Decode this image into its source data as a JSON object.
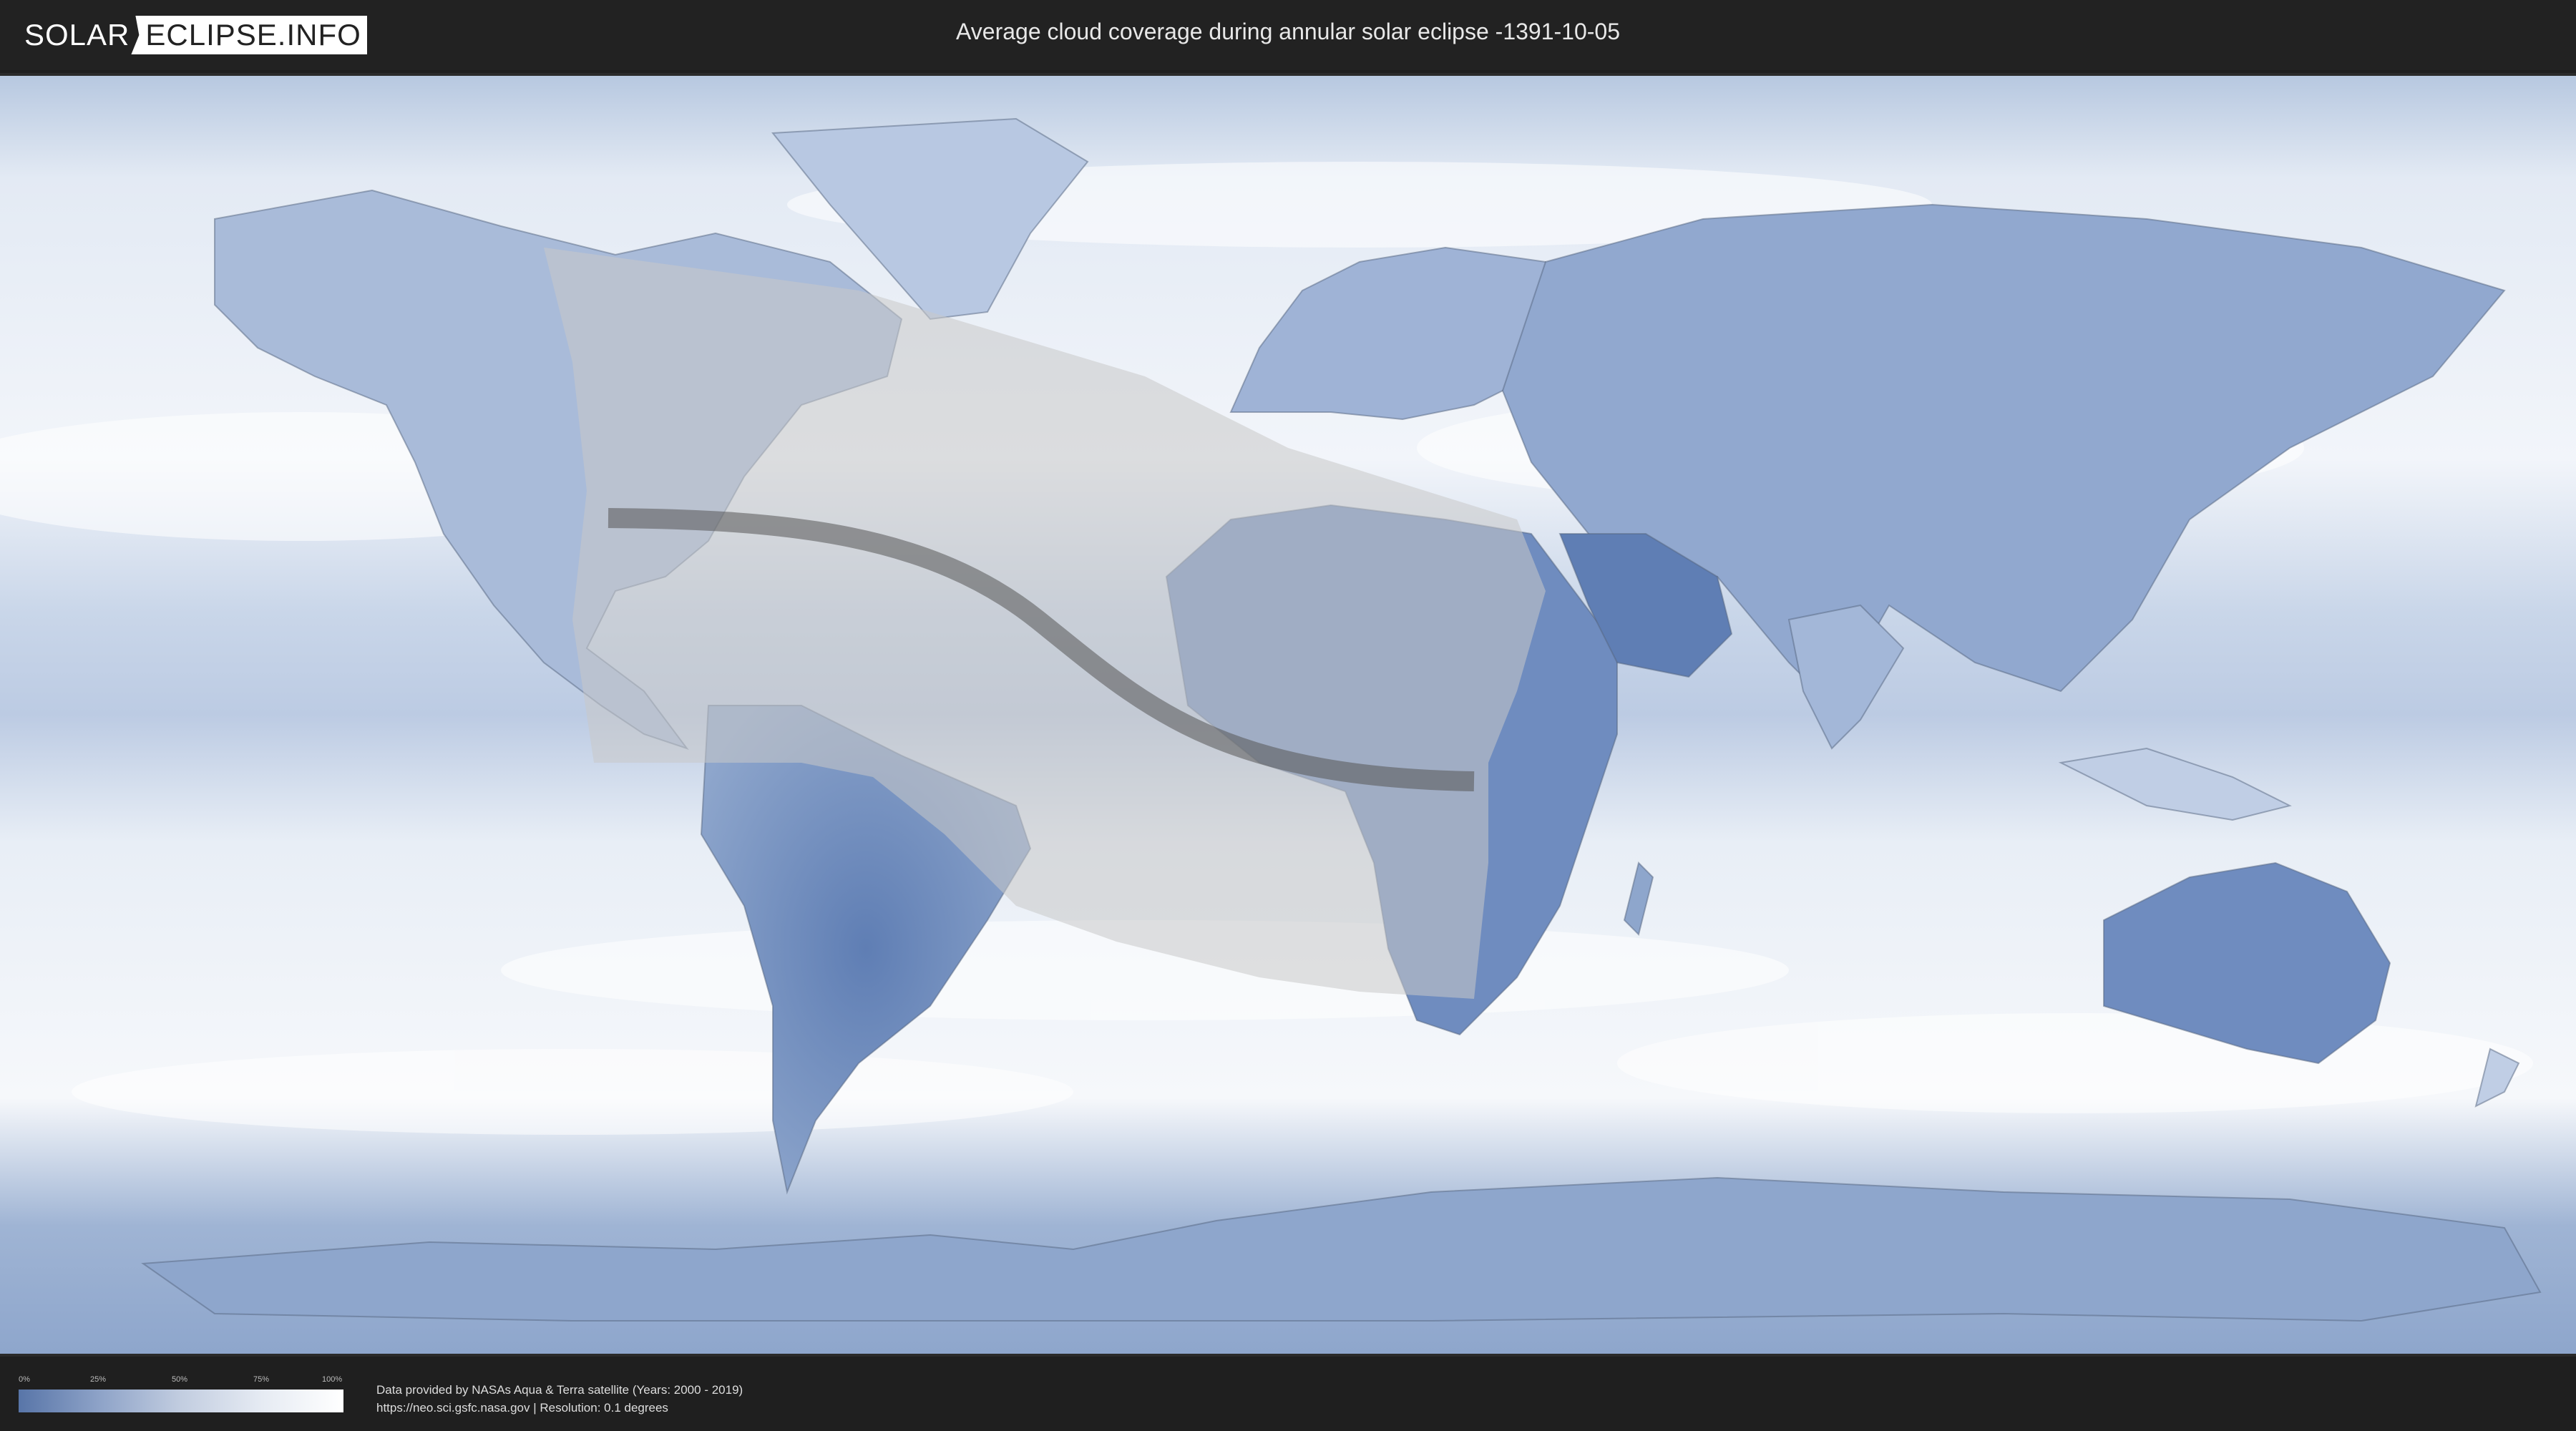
{
  "header": {
    "logo_left": "SOLAR",
    "logo_right": "ECLIPSE.INFO",
    "title": "Average cloud coverage during annular solar eclipse -1391-10-05"
  },
  "legend": {
    "ticks": [
      "0%",
      "25%",
      "50%",
      "75%",
      "100%"
    ],
    "colors": {
      "clear": "#5875a8",
      "cloudy": "#ffffff"
    }
  },
  "credits": {
    "line1": "Data provided by NASAs Aqua & Terra satellite (Years: 2000 - 2019)",
    "line2": "https://neo.sci.gsfc.nasa.gov | Resolution: 0.1 degrees"
  },
  "map": {
    "layer": "average cloud coverage",
    "colors": {
      "ocean_cloud": "#eef2f8",
      "land_clear": "#6f8cbf",
      "eclipse_zone": "#c8c8c8",
      "central_path": "#555555"
    }
  }
}
